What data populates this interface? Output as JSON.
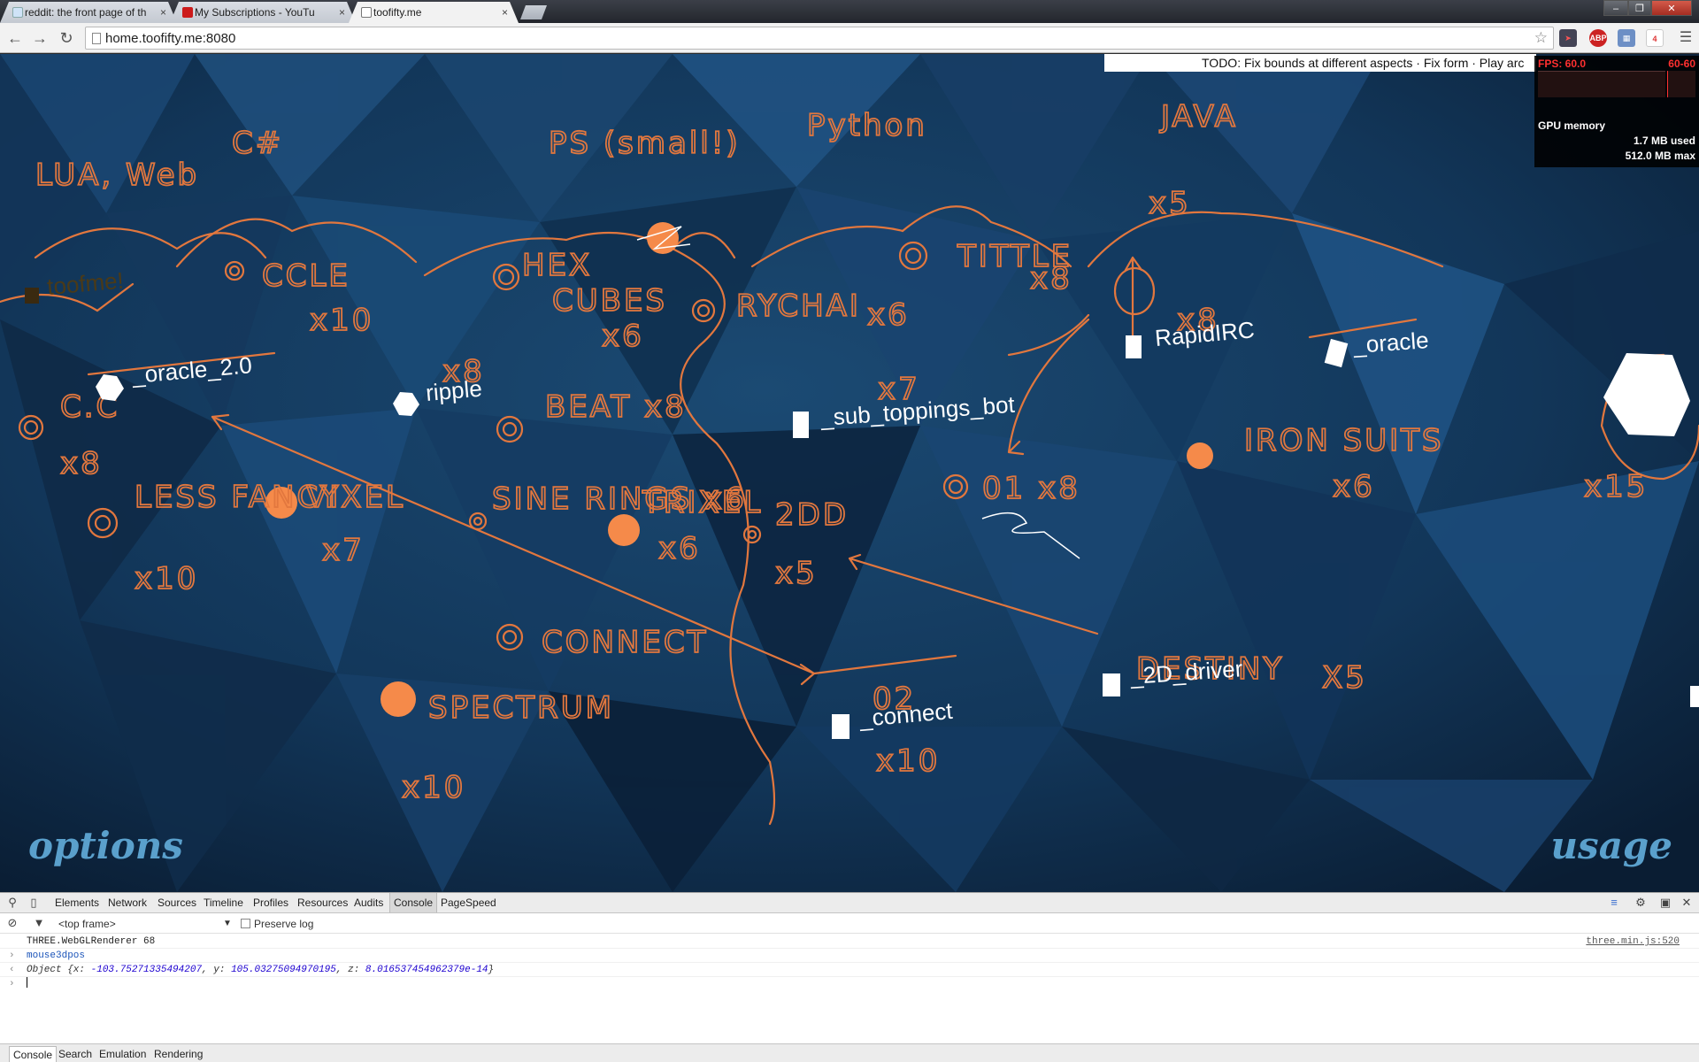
{
  "window": {
    "tabs": [
      {
        "title": "reddit: the front page of th",
        "favicon": "reddit-icon",
        "active": false
      },
      {
        "title": "My Subscriptions - YouTu",
        "favicon": "youtube-icon",
        "active": false
      },
      {
        "title": "toofifty.me",
        "favicon": "page-icon",
        "active": true
      }
    ],
    "close_glyph": "×"
  },
  "toolbar": {
    "url": "home.toofifty.me:8080",
    "extensions": [
      "rocket-icon",
      "adblock-icon",
      "calendar-icon",
      "gmail-icon"
    ],
    "abp_label": "ABP",
    "gmail_badge": "4"
  },
  "page": {
    "todo": "TODO: Fix bounds at different aspects · Fix form · Play arc",
    "stats": {
      "fps": "FPS: 60.0",
      "fps_range": "60-60",
      "gpu_title": "GPU memory",
      "gpu_used": "1.7 MB used",
      "gpu_max": "512.0 MB max"
    },
    "nodes": [
      "_oracle_2.0",
      "ripple",
      "_sub_toppings_bot",
      "RapidIRC",
      "_oracle",
      "_connect",
      "_2D_driver",
      "toofme!"
    ],
    "annotations": [
      "C#",
      "PS (small!)",
      "Python",
      "JAVA",
      "LUA, Web",
      "x5",
      "CCLE",
      "x10",
      "HEX",
      "CUBES",
      "x6",
      "RYCHAI",
      "x6",
      "TITTLE",
      "x8",
      "x8",
      "x15",
      "x8",
      "BEAT x8",
      "x7",
      "C.C",
      "x8",
      "LESS FANCY",
      "x10",
      "VIXEL",
      "x7",
      "SINE RINGS x6",
      "TRIXEL",
      "x6",
      "2DD",
      "x5",
      "01 x8",
      "IRON SUITS",
      "x6",
      "CONNECT",
      "SPECTRUM",
      "x10",
      "02",
      "x10",
      "DESTINY",
      "X5"
    ],
    "options_label": "options",
    "usage_label": "usage"
  },
  "devtools": {
    "tabs": [
      "Elements",
      "Network",
      "Sources",
      "Timeline",
      "Profiles",
      "Resources",
      "Audits",
      "Console",
      "PageSpeed"
    ],
    "selected_tab": "Console",
    "frame": "<top frame>",
    "preserve_log": "Preserve log",
    "console": {
      "renderer": "THREE.WebGLRenderer 68",
      "renderer_src": "three.min.js:520",
      "cmd": "mouse3dpos",
      "object_prefix": "Object {x: ",
      "x": "-103.75271335494207",
      "y_sep": ", y: ",
      "y": "105.03275094970195",
      "z_sep": ", z: ",
      "z": "8.016537454962379e-14",
      "object_suffix": "}"
    },
    "drawer_tabs": [
      "Console",
      "Search",
      "Emulation",
      "Rendering"
    ]
  }
}
